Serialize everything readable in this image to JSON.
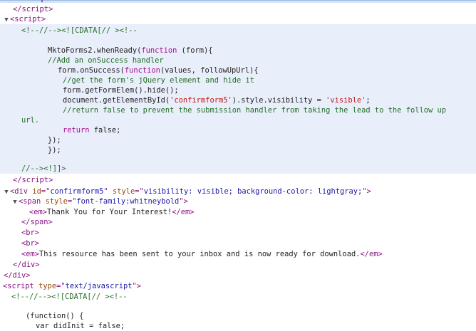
{
  "app": {
    "panel": "Elements",
    "colors": {
      "tag": "#881280",
      "attr_name": "#994500",
      "attr_value": "#1a1aa6",
      "comment": "#236e25",
      "keyword": "#aa0d91",
      "string": "#c41a16",
      "selected_background": "#e9eefb"
    }
  },
  "tokens": {
    "tag_script": "script",
    "tag_div": "div",
    "tag_span": "span",
    "tag_em": "em",
    "tag_br": "br",
    "attr_id": "id",
    "attr_style": "style",
    "attr_type": "type",
    "val_confirmform5": "confirmform5",
    "val_div_style": "visibility: visible; background-color: lightgray;",
    "val_span_style": "font-family:whitneybold",
    "val_text_js": "text/javascript",
    "cdata_open": "<!--//--><![CDATA[// ><!--",
    "cdata_close": "//--><!]]>"
  },
  "script1": {
    "l1_a": "MktoForms2.whenReady(",
    "l1_kw": "function",
    "l1_b": " (form){",
    "l2": "//Add an onSuccess handler",
    "l3_a": "form.onSuccess(",
    "l3_kw": "function",
    "l3_b": "(values, followUpUrl){",
    "l4": "//get the form's jQuery element and hide it",
    "l5": "form.getFormElem().hide();",
    "l6_a": "document.getElementById(",
    "l6_s1": "'confirmform5'",
    "l6_b": ").style.visibility = ",
    "l6_s2": "'visible'",
    "l6_c": ";",
    "l7": "//return false to prevent the submission handler from taking the lead to the follow up",
    "l7_wrap": "url.",
    "l8_kw": "return",
    "l8_b": " false;",
    "l9": "});",
    "l10": "});"
  },
  "confirm": {
    "thank_you": "Thank You for Your Interest!",
    "resource": "This resource has been sent to your inbox and is now ready for download."
  },
  "script2": {
    "l1": "(function() {",
    "l2": "var didInit = false;"
  }
}
